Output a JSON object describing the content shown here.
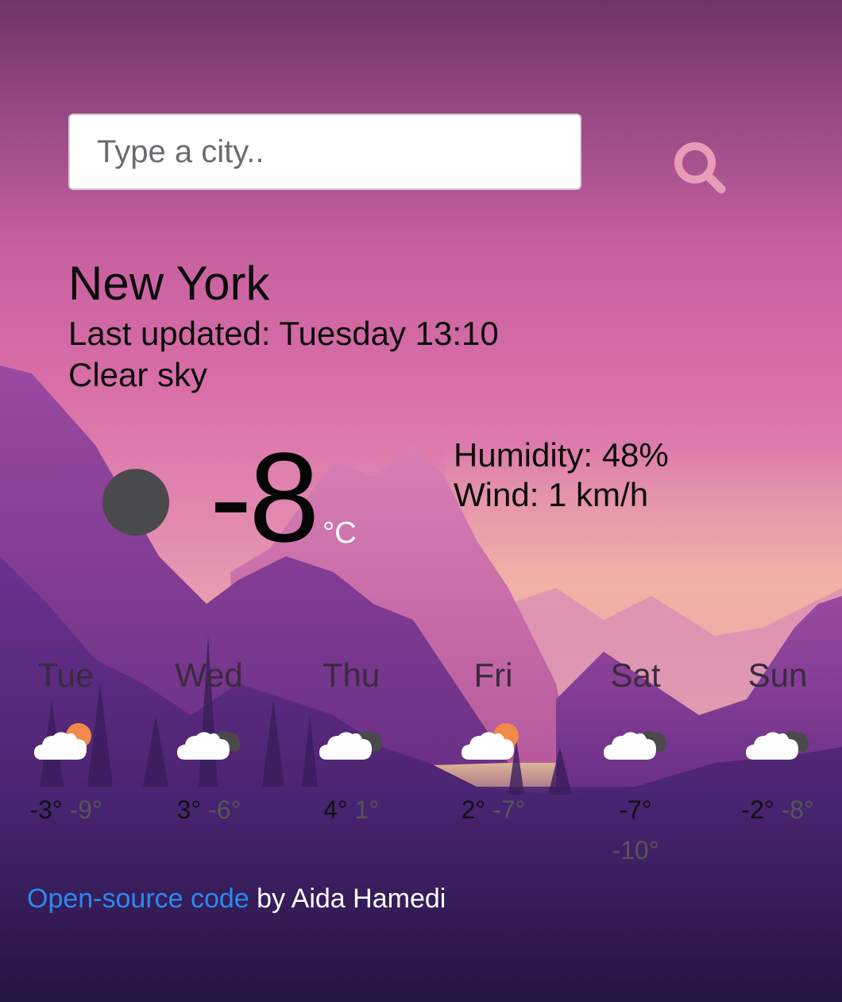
{
  "search": {
    "placeholder": "Type a city..",
    "value": ""
  },
  "current": {
    "city": "New York",
    "last_updated": "Last updated: Tuesday 13:10",
    "description": "Clear sky",
    "temperature": "-8",
    "unit": "°C",
    "humidity": "Humidity: 48%",
    "wind": "Wind: 1 km/h",
    "icon": "clear-sky-icon"
  },
  "forecast": [
    {
      "day": "Tue",
      "max": "-3°",
      "min": "-9°",
      "icon": "cloud-sun-icon"
    },
    {
      "day": "Wed",
      "max": "3°",
      "min": "-6°",
      "icon": "cloud-dark-cloud-icon"
    },
    {
      "day": "Thu",
      "max": "4°",
      "min": "1°",
      "icon": "cloud-dark-cloud-icon"
    },
    {
      "day": "Fri",
      "max": "2°",
      "min": "-7°",
      "icon": "cloud-sun-icon"
    },
    {
      "day": "Sat",
      "max": "-7°",
      "min": "-10°",
      "icon": "cloud-dark-cloud-icon"
    },
    {
      "day": "Sun",
      "max": "-2°",
      "min": "-8°",
      "icon": "cloud-dark-cloud-icon"
    }
  ],
  "footer": {
    "link_text": "Open-source code",
    "by_text": " by Aida Hamedi"
  },
  "colors": {
    "link": "#2a8af0",
    "search_icon": "#e89cb8",
    "sun": "#f08a4b",
    "dark_cloud": "#4a4a4c"
  }
}
